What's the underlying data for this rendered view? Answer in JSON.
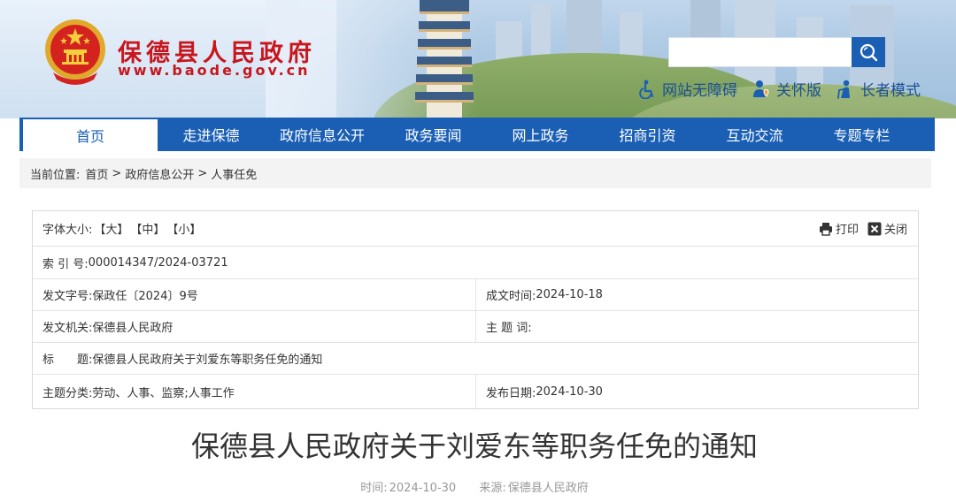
{
  "header": {
    "site_name": "保德县人民政府",
    "site_url": "www.baode.gov.cn",
    "search_placeholder": "",
    "tools": [
      {
        "label": "网站无障碍",
        "icon": "wheelchair-icon"
      },
      {
        "label": "关怀版",
        "icon": "care-person-icon"
      },
      {
        "label": "长者模式",
        "icon": "elder-person-icon"
      }
    ]
  },
  "nav": {
    "items": [
      "首页",
      "走进保德",
      "政府信息公开",
      "政务要闻",
      "网上政务",
      "招商引资",
      "互动交流",
      "专题专栏"
    ]
  },
  "breadcrumb": {
    "prefix": "当前位置:",
    "items": [
      "首页",
      "政府信息公开",
      "人事任免"
    ],
    "separator": ">"
  },
  "info": {
    "font_size_label": "字体大小:",
    "font_size_options": [
      "【大】",
      "【中】",
      "【小】"
    ],
    "print_label": "打印",
    "close_label": "关闭",
    "index_label": "索 引 号:",
    "index_value": "000014347/2024-03721",
    "doc_no_label": "发文字号:",
    "doc_no_value": "保政任〔2024〕9号",
    "written_date_label": "成文时间:",
    "written_date_value": "2024-10-18",
    "issuer_label": "发文机关:",
    "issuer_value": "保德县人民政府",
    "keywords_label": "主 题 词:",
    "keywords_value": "",
    "title_label": "标　　题:",
    "title_value": "保德县人民政府关于刘爱东等职务任免的通知",
    "category_label": "主题分类:",
    "category_value": "劳动、人事、监察;人事工作",
    "publish_date_label": "发布日期:",
    "publish_date_value": "2024-10-30"
  },
  "article": {
    "title": "保德县人民政府关于刘爱东等职务任免的通知",
    "time_label": "时间:",
    "time_value": "2024-10-30",
    "source_label": "来源:",
    "source_value": "保德县人民政府"
  },
  "colors": {
    "brand_red": "#c8161d",
    "nav_blue": "#1a5fb4"
  }
}
